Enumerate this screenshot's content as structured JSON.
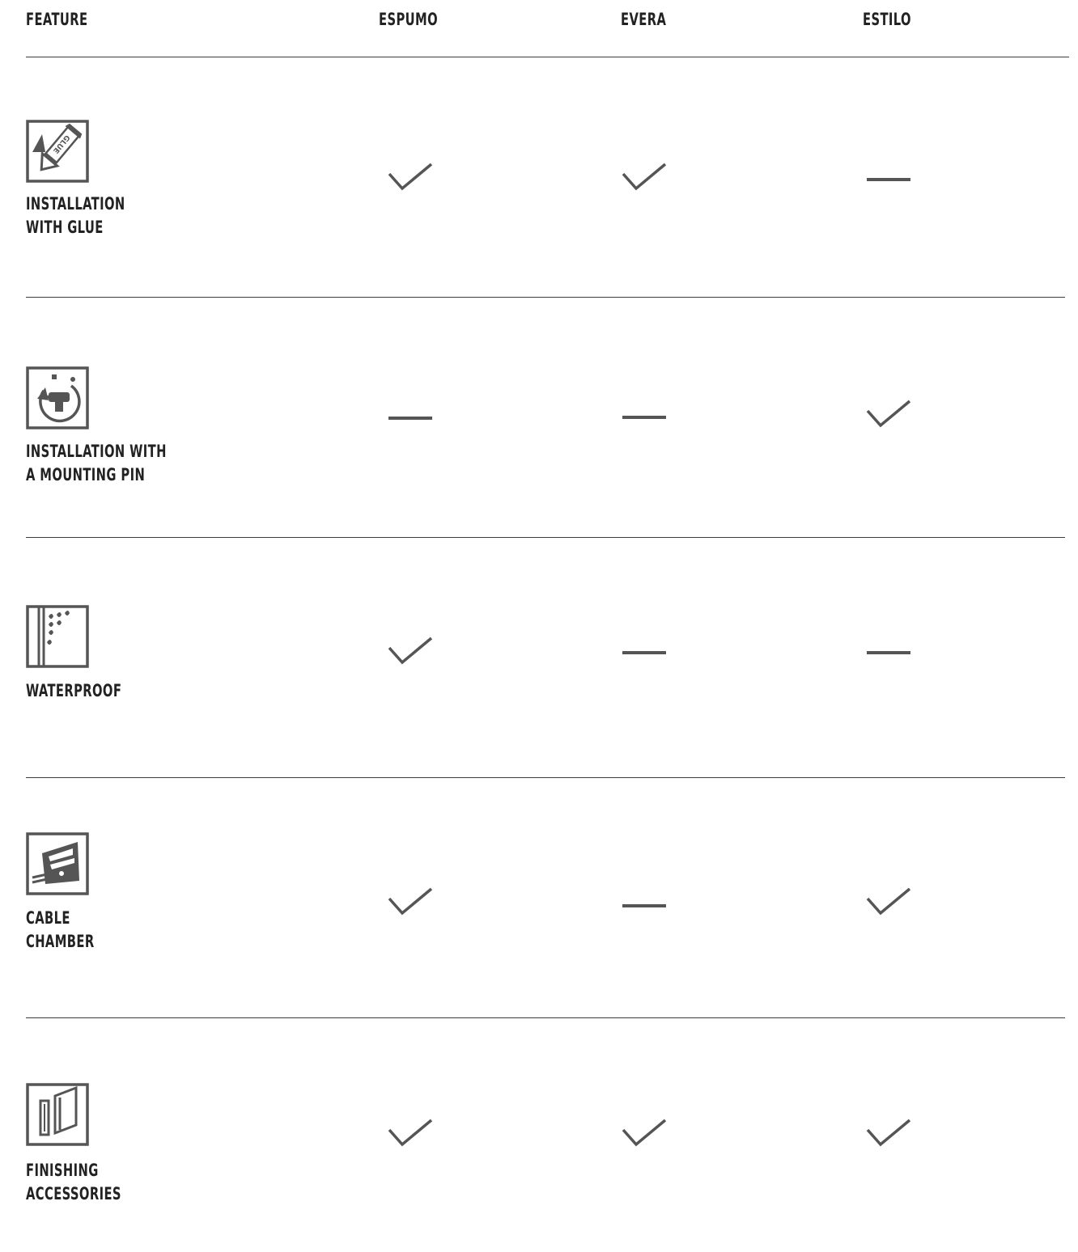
{
  "header": {
    "feature": "FEATURE",
    "products": [
      "ESPUMO",
      "EVERA",
      "ESTILO"
    ]
  },
  "colors": {
    "ink": "#222222",
    "mark": "#555555",
    "rule": "#3c3c3c"
  },
  "rows": [
    {
      "icon": "glue-tube-icon",
      "icon_text": "GLUE",
      "label_lines": [
        "INSTALLATION",
        "WITH GLUE"
      ],
      "values": [
        "check",
        "check",
        "dash"
      ]
    },
    {
      "icon": "drill-rotate-icon",
      "label_lines": [
        "INSTALLATION WITH",
        "A MOUNTING PIN"
      ],
      "values": [
        "dash",
        "dash",
        "check"
      ]
    },
    {
      "icon": "water-drops-icon",
      "label_lines": [
        "WATERPROOF"
      ],
      "values": [
        "check",
        "dash",
        "dash"
      ]
    },
    {
      "icon": "cable-chamber-icon",
      "label_lines": [
        "CABLE",
        "CHAMBER"
      ],
      "values": [
        "check",
        "dash",
        "check"
      ]
    },
    {
      "icon": "finishing-accessories-icon",
      "label_lines": [
        "FINISHING",
        "ACCESSORIES"
      ],
      "values": [
        "check",
        "check",
        "check"
      ]
    }
  ]
}
